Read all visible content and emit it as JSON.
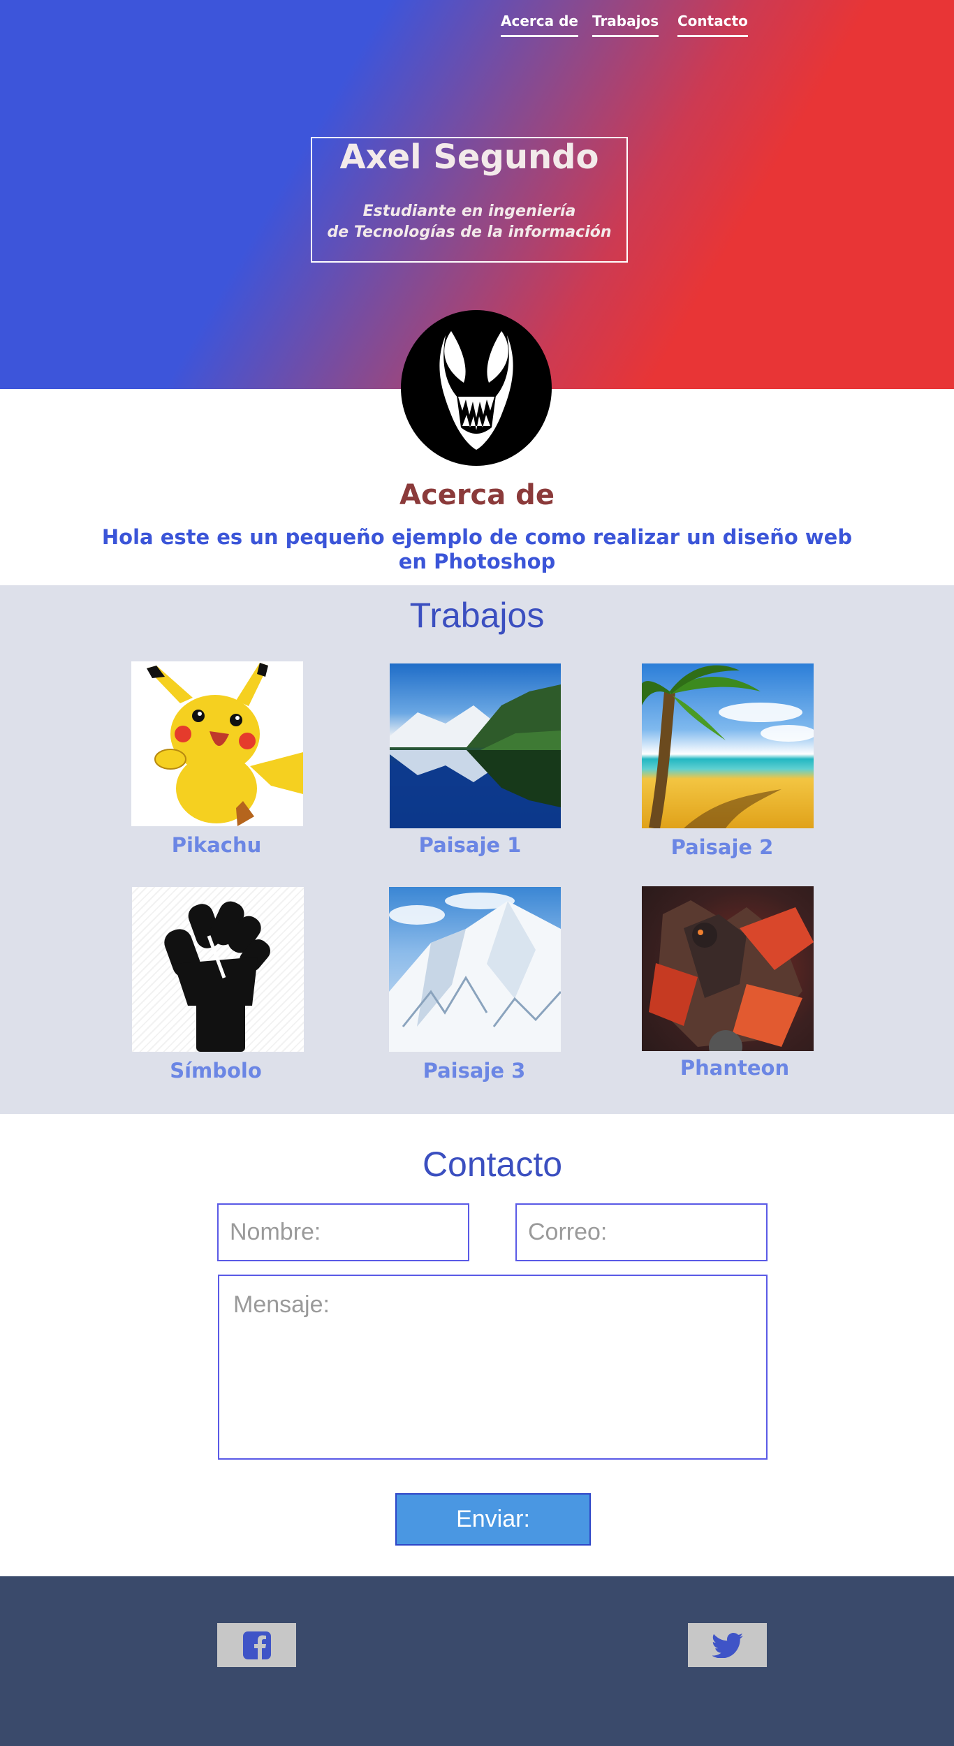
{
  "nav": {
    "about": "Acerca de",
    "works": "Trabajos",
    "contact": "Contacto"
  },
  "hero": {
    "name": "Axel Segundo",
    "subtitle_line1": "Estudiante en ingeniería",
    "subtitle_line2": "de Tecnologías de la información"
  },
  "about": {
    "heading": "Acerca de",
    "text_line1": "Hola este es un pequeño ejemplo de como realizar un diseño web",
    "text_line2": "en Photoshop"
  },
  "works": {
    "heading": "Trabajos",
    "items": [
      {
        "label": "Pikachu",
        "image": "pikachu"
      },
      {
        "label": "Paisaje 1",
        "image": "lake-mountains"
      },
      {
        "label": "Paisaje 2",
        "image": "beach-palm"
      },
      {
        "label": "Símbolo",
        "image": "raised-fist"
      },
      {
        "label": "Paisaje 3",
        "image": "snowy-mountain"
      },
      {
        "label": "Phanteon",
        "image": "armored-warrior"
      }
    ]
  },
  "contact": {
    "heading": "Contacto",
    "name_placeholder": "Nombre:",
    "email_placeholder": "Correo:",
    "message_placeholder": "Mensaje:",
    "send_label": "Enviar:"
  },
  "footer": {
    "social": [
      "facebook-icon",
      "twitter-icon"
    ]
  },
  "colors": {
    "hero_blue": "#3d55da",
    "hero_red": "#e83536",
    "about_heading": "#8b3a3a",
    "about_text": "#3b55d8",
    "works_bg": "#dde0ea",
    "work_label": "#6b86e4",
    "button": "#4a97e2",
    "footer_bg": "#3a4a6b"
  }
}
